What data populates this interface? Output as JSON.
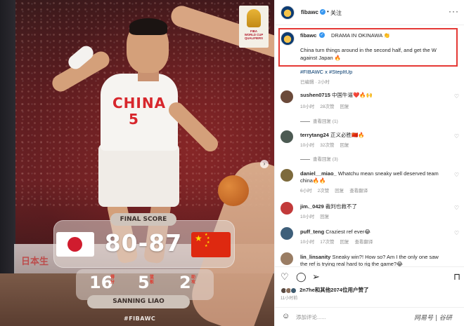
{
  "photo": {
    "badge_lines": [
      "FIBA",
      "WORLD CUP",
      "QUALIFIERS"
    ],
    "jersey_text": "CHINA",
    "jersey_number": "5",
    "ad_text": "日本生",
    "final_score_label": "FINAL SCORE",
    "score": "80-87",
    "stats": [
      {
        "value": "16",
        "unit": "得分"
      },
      {
        "value": "5",
        "unit": "篮板"
      },
      {
        "value": "2",
        "unit": "助攻"
      }
    ],
    "player_name": "SANNING LIAO",
    "hashtag": "#FIBAWC",
    "next_icon": "chevron-right-icon"
  },
  "header": {
    "username": "fibawc",
    "verified_icon": "verified-badge-icon",
    "separator": "•",
    "follow_label": "关注",
    "more_icon": "more-horizontal-icon"
  },
  "caption": {
    "username": "fibawc",
    "title": "DRAMA IN OKINAWA 👏",
    "body": "China turn things around in the second half, and get the W against Japan 🔥",
    "tags": "#FIBAWC x #StepItUp",
    "meta": "已编辑 · 2小时",
    "highlight_color": "#e53935"
  },
  "comments": [
    {
      "username": "sushen0715",
      "text": "中国牛逼❤️🔥🙌",
      "time": "10小时",
      "likes": "28次赞",
      "reply": "回复",
      "view_replies": "查看回复 (1)",
      "avatar_color": "#6b4a3a"
    },
    {
      "username": "terrytang24",
      "text": "正义必胜🇨🇳🔥",
      "time": "10小时",
      "likes": "32次赞",
      "reply": "回复",
      "view_replies": "查看回复 (3)",
      "avatar_color": "#4c5a52"
    },
    {
      "username": "daniel__miao_",
      "text": "Whatchu mean sneaky well deserved team china🔥🔥",
      "time": "6小时",
      "likes": "2次赞",
      "reply": "回复",
      "translate": "查看翻译",
      "avatar_color": "#7d6a3c"
    },
    {
      "username": "jim._0429",
      "text": "裁判也救不了",
      "time": "10小时",
      "likes": "",
      "reply": "回复",
      "avatar_color": "#c23a3a"
    },
    {
      "username": "puff_teng",
      "text": "Craziest ref ever😂",
      "time": "10小时",
      "likes": "17次赞",
      "reply": "回复",
      "translate": "查看翻译",
      "avatar_color": "#3e5f7a"
    },
    {
      "username": "lin_linsanity",
      "text": "Sneaky win?! How so? Am I the only one saw the ref is trying real hard to rig the game?😂",
      "time": "",
      "likes": "",
      "reply": "",
      "avatar_color": "#9a7d64"
    }
  ],
  "actions": {
    "like_icon": "heart-icon",
    "comment_icon": "comment-icon",
    "share_icon": "send-icon",
    "save_icon": "bookmark-icon"
  },
  "likes_text": "2n7he和其他2074位用户赞了",
  "post_time": "11小时前",
  "add_comment": {
    "emoji_icon": "smile-icon",
    "placeholder": "添加评论......"
  },
  "watermark": "网易号 | 谷研"
}
